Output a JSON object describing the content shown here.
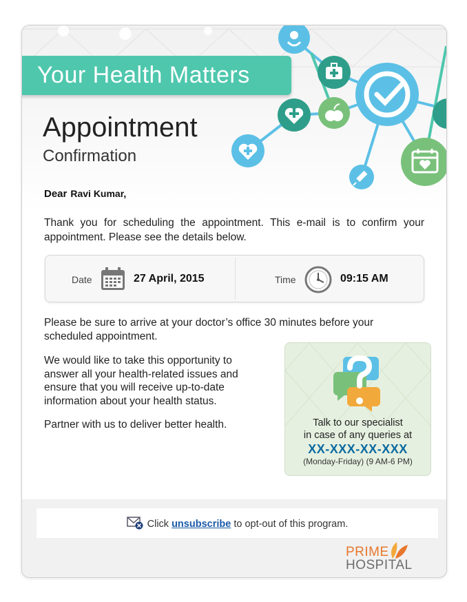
{
  "banner": {
    "title": "Your Health Matters"
  },
  "heading": {
    "title": "Appointment",
    "subtitle": "Confirmation"
  },
  "greeting": {
    "salutation": "Dear",
    "name": "Ravi Kumar,"
  },
  "intro": "Thank you for scheduling the appointment. This e-mail is to confirm your appointment. Please see the details below.",
  "appointment": {
    "date_label": "Date",
    "date_value": "27 April, 2015",
    "time_label": "Time",
    "time_value": "09:15 AM"
  },
  "arrival_note": "Please be sure to arrive at your doctor’s office 30 minutes before your scheduled appointment.",
  "opportunity": "We would like to take this opportunity to answer all your health-related issues and ensure that you will receive up-to-date information about your health status.",
  "partner": "Partner with us to deliver better health.",
  "specialist": {
    "line1": "Talk to our specialist",
    "line2": "in case of any queries at",
    "phone": "XX-XXX-XX-XXX",
    "hours": "(Monday-Friday) (9 AM-6 PM)"
  },
  "footer": {
    "prefix": "Click",
    "link": "unsubscribe",
    "suffix": "to opt-out of this program."
  },
  "logo": {
    "line1": "PRIME",
    "line2": "HOSPITAL"
  },
  "colors": {
    "banner": "#4ec7ad",
    "phone": "#0b6aa0",
    "link": "#1a5aa8",
    "logo_orange": "#e8772e"
  },
  "icons": [
    "stethoscope-icon",
    "first-aid-kit-icon",
    "check-icon",
    "medical-cross-icon",
    "apple-icon",
    "heart-plus-icon",
    "syringe-icon",
    "calendar-heart-icon",
    "calendar-icon",
    "clock-icon",
    "question-speech-icon",
    "mail-close-icon",
    "leaf-logo-icon"
  ]
}
